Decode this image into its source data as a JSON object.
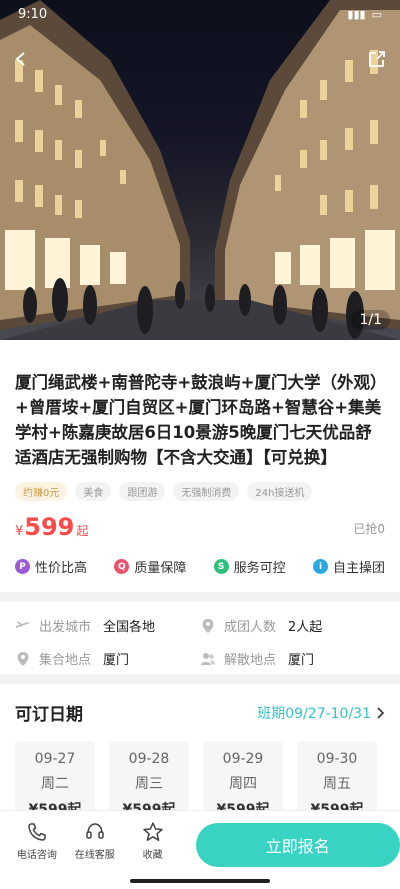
{
  "status_bar": {
    "time": "9:10",
    "battery": ""
  },
  "hero": {
    "counter": "1/1"
  },
  "product": {
    "title": "厦门绳武楼+南普陀寺+鼓浪屿+厦门大学（外观）+曾厝垵+厦门自贸区+厦门环岛路+智慧谷+集美学村+陈嘉庚故居6日10景游5晚厦门七天优品舒适酒店无强制购物【不含大交通】【可兑换】",
    "tags": [
      "约赚0元",
      "美食",
      "跟团游",
      "无强制消费",
      "24h接送机"
    ],
    "price_currency": "¥",
    "price_value": "599",
    "price_suffix": "起",
    "sold": "已抢0"
  },
  "guarantees": [
    {
      "label": "性价比高",
      "icon": "value-icon",
      "color": "#9b59d6",
      "glyph": "P"
    },
    {
      "label": "质量保障",
      "icon": "quality-icon",
      "color": "#e8546b",
      "glyph": "Q"
    },
    {
      "label": "服务可控",
      "icon": "service-icon",
      "color": "#2ec07a",
      "glyph": "S"
    },
    {
      "label": "自主操团",
      "icon": "self-op-icon",
      "color": "#2aa9e0",
      "glyph": "i"
    }
  ],
  "info": {
    "departure_label": "出发城市",
    "departure_value": "全国各地",
    "group_label": "成团人数",
    "group_value": "2人起",
    "assembly_label": "集合地点",
    "assembly_value": "厦门",
    "dismiss_label": "解散地点",
    "dismiss_value": "厦门"
  },
  "dates": {
    "title": "可订日期",
    "range": "班期09/27-10/31",
    "items": [
      {
        "date": "09-27",
        "week": "周二",
        "price": "¥599起"
      },
      {
        "date": "09-28",
        "week": "周三",
        "price": "¥599起"
      },
      {
        "date": "09-29",
        "week": "周四",
        "price": "¥599起"
      },
      {
        "date": "09-30",
        "week": "周五",
        "price": "¥599起"
      }
    ]
  },
  "bottom": {
    "phone": "电话咨询",
    "service": "在线客服",
    "favorite": "收藏",
    "cta": "立即报名"
  }
}
